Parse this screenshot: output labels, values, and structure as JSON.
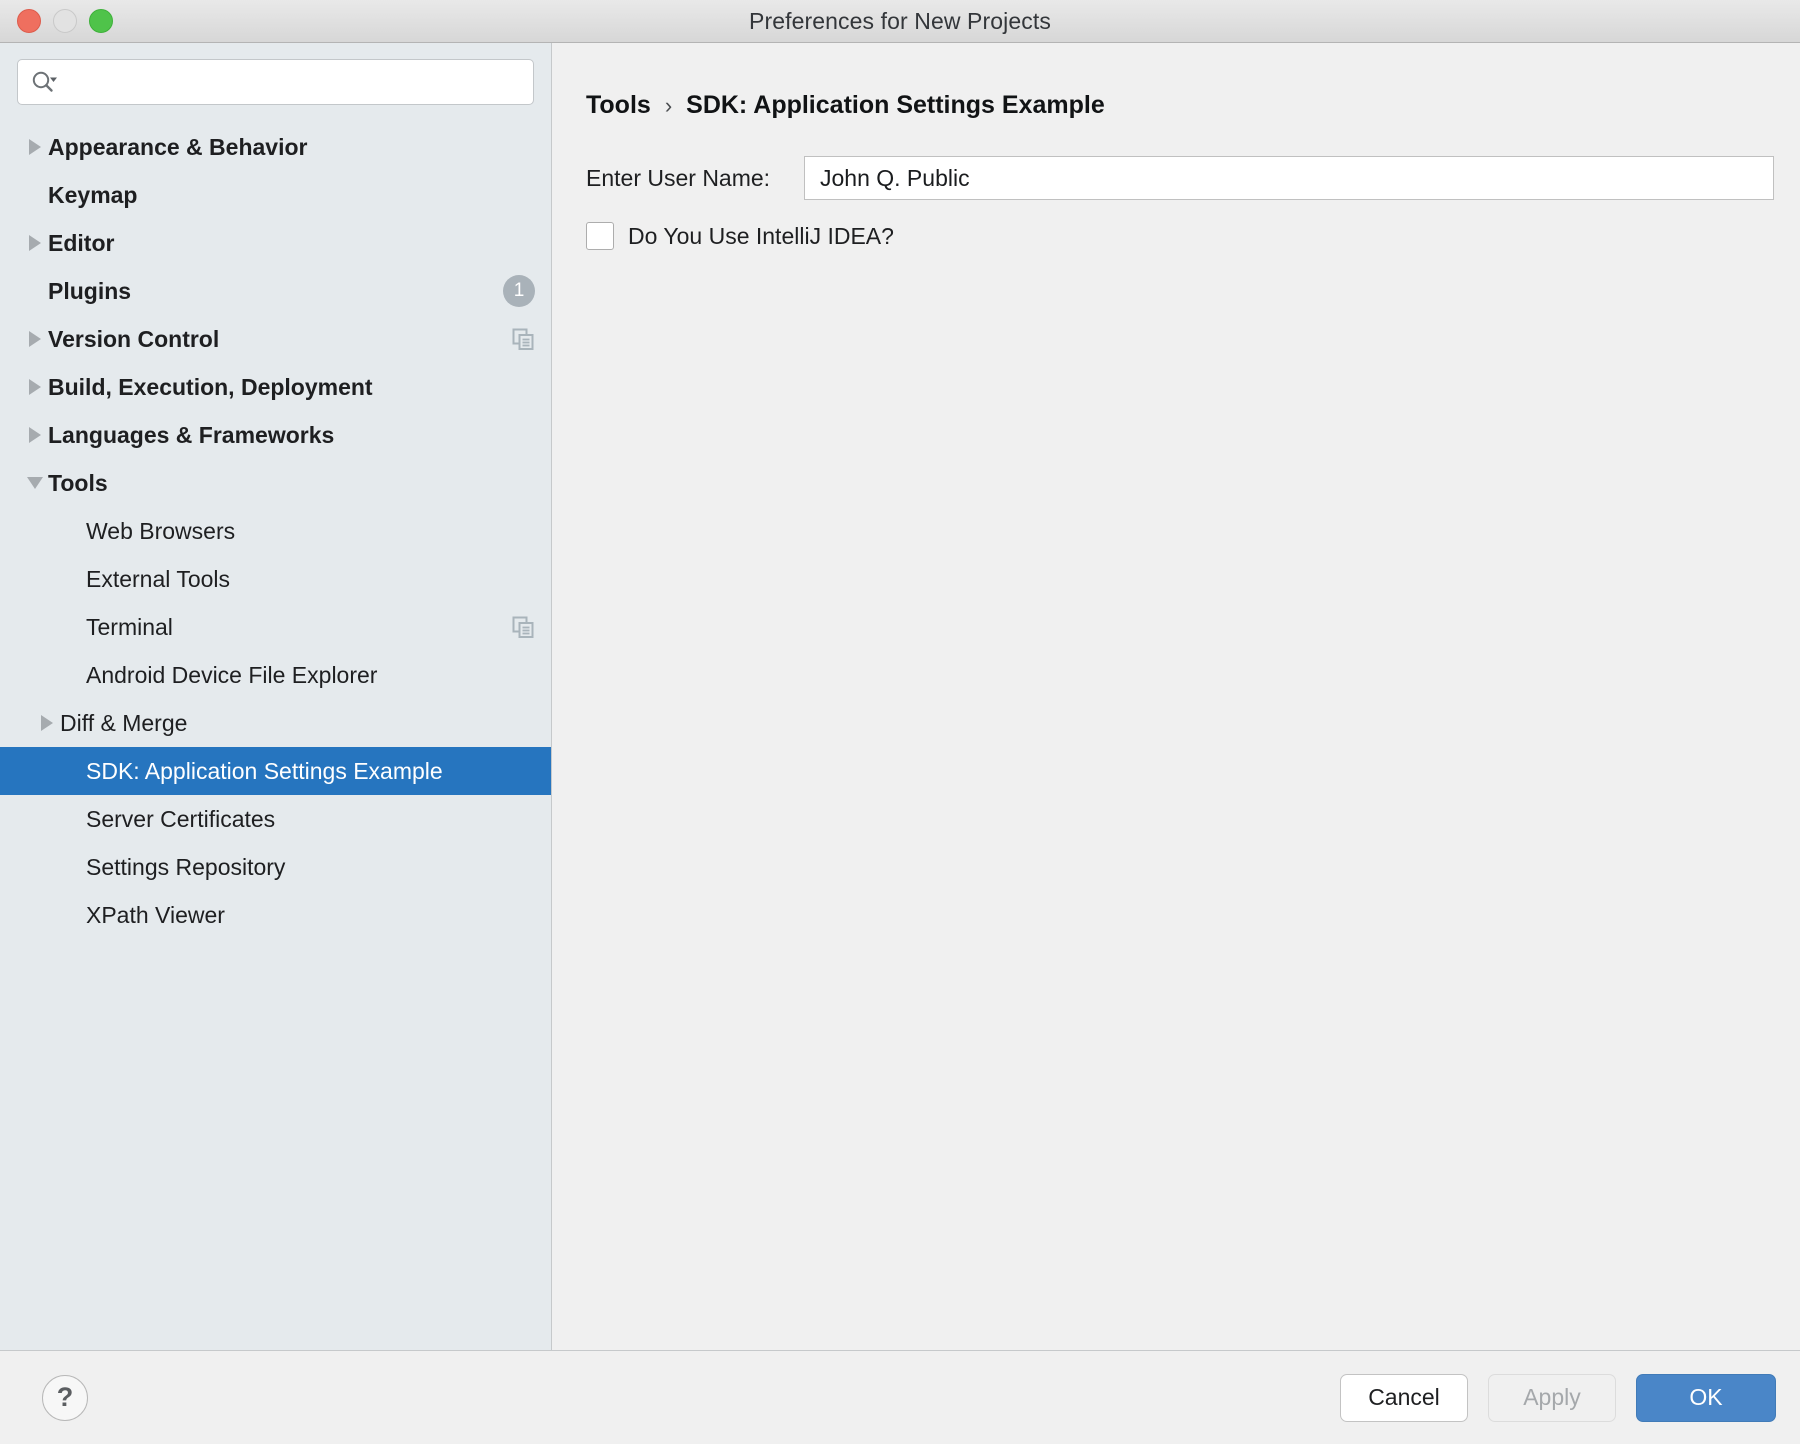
{
  "window": {
    "title": "Preferences for New Projects",
    "controls": [
      {
        "name": "close",
        "color": "#ef6f5f"
      },
      {
        "name": "minimize",
        "color": "#e2e2e2"
      },
      {
        "name": "maximize",
        "color": "#4fc34a"
      }
    ]
  },
  "sidebar": {
    "search": {
      "value": "",
      "placeholder": ""
    },
    "items": [
      {
        "label": "Appearance & Behavior",
        "level": 0,
        "twisty": "collapsed",
        "selected": false
      },
      {
        "label": "Keymap",
        "level": 0,
        "twisty": "none",
        "selected": false
      },
      {
        "label": "Editor",
        "level": 0,
        "twisty": "collapsed",
        "selected": false
      },
      {
        "label": "Plugins",
        "level": 0,
        "twisty": "none",
        "selected": false,
        "badge": "1"
      },
      {
        "label": "Version Control",
        "level": 0,
        "twisty": "collapsed",
        "selected": false,
        "trailing_icon": "copy-icon"
      },
      {
        "label": "Build, Execution, Deployment",
        "level": 0,
        "twisty": "collapsed",
        "selected": false
      },
      {
        "label": "Languages & Frameworks",
        "level": 0,
        "twisty": "collapsed",
        "selected": false
      },
      {
        "label": "Tools",
        "level": 0,
        "twisty": "expanded",
        "selected": false
      },
      {
        "label": "Web Browsers",
        "level": 1,
        "twisty": "none",
        "selected": false
      },
      {
        "label": "External Tools",
        "level": 1,
        "twisty": "none",
        "selected": false
      },
      {
        "label": "Terminal",
        "level": 1,
        "twisty": "none",
        "selected": false,
        "trailing_icon": "copy-icon"
      },
      {
        "label": "Android Device File Explorer",
        "level": 1,
        "twisty": "none",
        "selected": false
      },
      {
        "label": "Diff & Merge",
        "level": 1,
        "twisty": "collapsed",
        "selected": false
      },
      {
        "label": "SDK: Application Settings Example",
        "level": 1,
        "twisty": "none",
        "selected": true
      },
      {
        "label": "Server Certificates",
        "level": 1,
        "twisty": "none",
        "selected": false
      },
      {
        "label": "Settings Repository",
        "level": 1,
        "twisty": "none",
        "selected": false
      },
      {
        "label": "XPath Viewer",
        "level": 1,
        "twisty": "none",
        "selected": false
      }
    ],
    "selection_color": "#2675bf"
  },
  "main": {
    "breadcrumb": {
      "parent": "Tools",
      "separator": "›",
      "current": "SDK: Application Settings Example"
    },
    "form": {
      "user_name_label": "Enter User Name:",
      "user_name_value": "John Q. Public",
      "user_name_placeholder": "",
      "checkbox_label": "Do You Use IntelliJ IDEA?",
      "checkbox_checked": false
    }
  },
  "footer": {
    "help_label": "?",
    "cancel_label": "Cancel",
    "apply_label": "Apply",
    "apply_enabled": false,
    "ok_label": "OK",
    "ok_color": "#4a86c8"
  }
}
